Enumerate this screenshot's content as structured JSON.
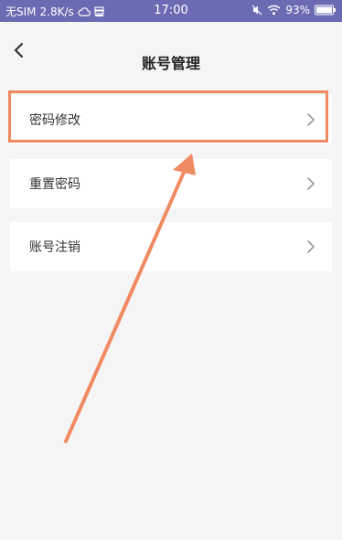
{
  "status_bar": {
    "carrier": "无SIM",
    "speed": "2.8K/s",
    "time": "17:00",
    "battery": "93%",
    "icons": [
      "cloud-icon",
      "storage-icon",
      "mute-icon",
      "wifi-icon",
      "battery-icon"
    ]
  },
  "header": {
    "title": "账号管理",
    "back_icon": "chevron-left-icon"
  },
  "menu": [
    {
      "label": "密码修改",
      "highlighted": true
    },
    {
      "label": "重置密码",
      "highlighted": false
    },
    {
      "label": "账号注销",
      "highlighted": false
    }
  ],
  "annotation": {
    "color": "#f08a62",
    "type": "arrow pointing to highlighted item"
  },
  "colors": {
    "status_bar": "#6b6bb3",
    "background": "#f5f5f5",
    "card": "#ffffff"
  }
}
